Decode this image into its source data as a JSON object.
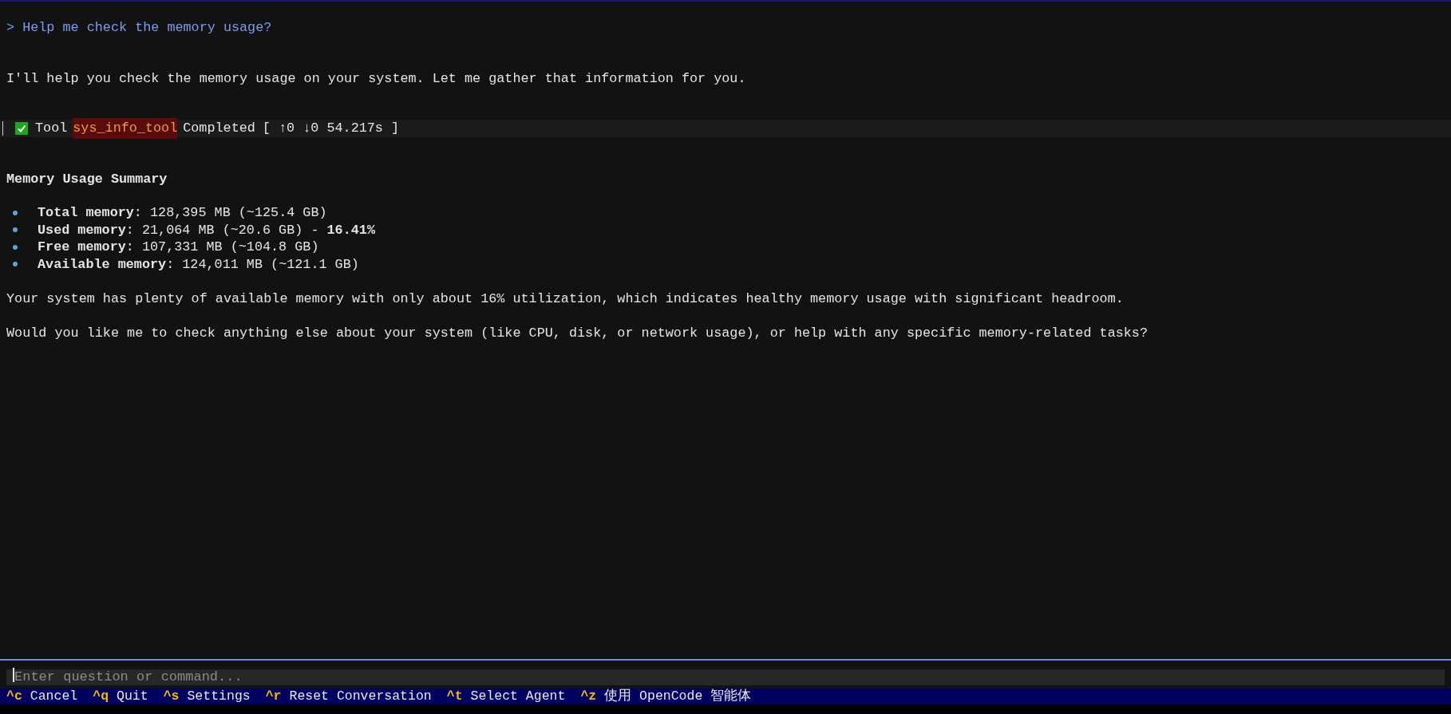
{
  "prompt": "> Help me check the memory usage?",
  "reply_intro": "I'll help you check the memory usage on your system. Let me gather that information for you.",
  "tool_call": {
    "label": "Tool",
    "name": "sys_info_tool",
    "status": "Completed",
    "stats": "[ ↑0 ↓0 54.217s ]"
  },
  "heading": "Memory Usage Summary",
  "bullets": [
    {
      "label": "Total memory",
      "value": ": 128,395 MB (~125.4 GB)"
    },
    {
      "label": "Used memory",
      "value": ": 21,064 MB (~20.6 GB) - **16.41%**"
    },
    {
      "label": "Free memory",
      "value": ": 107,331 MB (~104.8 GB)"
    },
    {
      "label": "Available memory",
      "value": ": 124,011 MB (~121.1 GB)"
    }
  ],
  "paragraphs": [
    "Your system has plenty of available memory with only about 16% utilization, which indicates healthy memory usage with significant headroom.",
    "Would you like me to check anything else about your system (like CPU, disk, or network usage), or help with any specific memory-related tasks?"
  ],
  "input": {
    "placeholder": "Enter question or command..."
  },
  "shortcuts": [
    {
      "key": "^c",
      "label": "Cancel"
    },
    {
      "key": "^q",
      "label": "Quit"
    },
    {
      "key": "^s",
      "label": "Settings"
    },
    {
      "key": "^r",
      "label": "Reset Conversation"
    },
    {
      "key": "^t",
      "label": "Select Agent"
    },
    {
      "key": "^z",
      "label": "使用 OpenCode 智能体"
    }
  ]
}
